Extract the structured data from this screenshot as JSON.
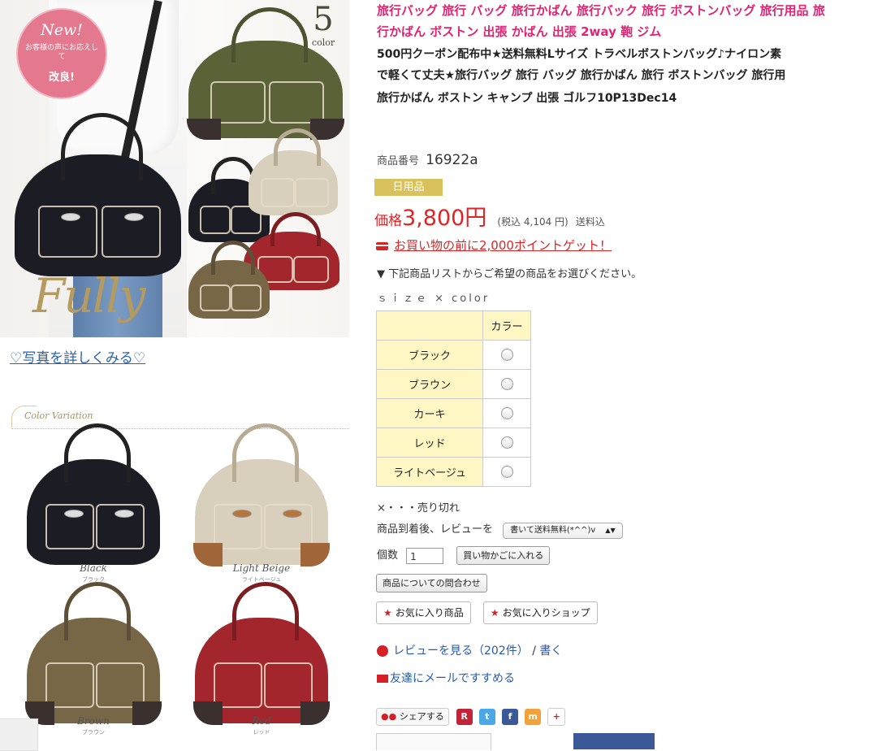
{
  "hero": {
    "new_title": "New!",
    "new_text": "お客様の声にお応えして",
    "new_improved": "改良!",
    "color_count": "5",
    "color_label": "color",
    "brand_script": "Fully"
  },
  "photo_link": "♡写真を詳しくみる♡",
  "variation": {
    "header": "Color Variation",
    "items": [
      {
        "name": "Black",
        "sub": "ブラック"
      },
      {
        "name": "Light Beige",
        "sub": "ライトベージュ"
      },
      {
        "name": "Brown",
        "sub": "ブラウン"
      },
      {
        "name": "Red",
        "sub": "レッド"
      }
    ]
  },
  "product": {
    "title_line1": "旅行バッグ 旅行 バッグ 旅行かばん 旅行バック 旅行 ボストンバッグ 旅行用品 旅",
    "title_line2": "行かばん ボストン 出張 かばん 出張 2way 鞄 ジム",
    "desc_line1": "500円クーポン配布中★送料無料Lサイズ トラベルボストンバッグ♪ナイロン素",
    "desc_line2": "で軽くて丈夫★旅行バッグ 旅行 バッグ 旅行かばん 旅行 ボストンバッグ 旅行用",
    "desc_line3": "旅行かばん ボストン キャンプ 出張 ゴルフ10P13Dec14",
    "item_no_label": "商品番号",
    "item_no": "16922a",
    "category": "日用品",
    "price_label": "価格",
    "price": "3,800円",
    "tax_note": "(税込 4,104 円)",
    "shipping": "送料込",
    "points": "お買い物の前に2,000ポイントゲット！",
    "choose_note": "▼ 下記商品リストからご希望の商品をお選びください。",
    "size_color": "ｓｉｚｅ × color",
    "table_header": "カラー",
    "colors": [
      "ブラック",
      "ブラウン",
      "カーキ",
      "レッド",
      "ライトベージュ"
    ],
    "soldout_note": "×・・・売り切れ",
    "review_prompt": "商品到着後、レビューを",
    "review_select": "書いて送料無料(*^^)v",
    "qty_label": "個数",
    "qty_value": "1",
    "cart_button": "買い物かごに入れる",
    "inquiry_button": "商品についての問合わせ",
    "fav_item": "お気に入り商品",
    "fav_shop": "お気に入りショップ",
    "review_link": "レビューを見る（202件）",
    "review_sep": "/",
    "review_write": "書く",
    "mail_link": "友達にメールですすめる",
    "share_label": "シェアする"
  },
  "colors": {
    "accent_pink": "#e02472",
    "price_red": "#e02424",
    "link_blue": "#2a5aab",
    "category_gold": "#d9c15d",
    "table_yellow": "#fff7c3"
  }
}
